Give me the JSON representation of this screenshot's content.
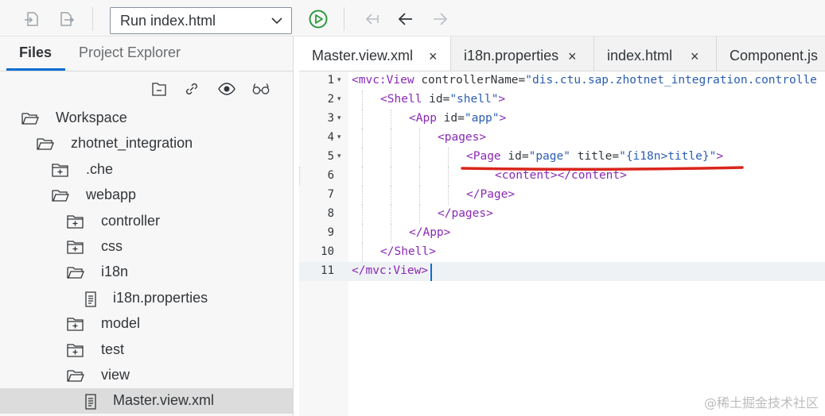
{
  "toolbar": {
    "run_config_label": "Run index.html",
    "icons": [
      "import-icon",
      "export-icon",
      "run-icon",
      "step-back-icon",
      "back-icon",
      "forward-icon"
    ]
  },
  "left_pane": {
    "tabs": [
      {
        "label": "Files",
        "active": true
      },
      {
        "label": "Project Explorer",
        "active": false
      }
    ],
    "action_icons": [
      "new-folder-icon",
      "link-icon",
      "eye-icon",
      "glasses-icon"
    ],
    "tree": [
      {
        "label": "Workspace",
        "type": "folder-open",
        "depth": 0
      },
      {
        "label": "zhotnet_integration",
        "type": "folder-open",
        "depth": 1
      },
      {
        "label": ".che",
        "type": "folder-closed",
        "depth": 2
      },
      {
        "label": "webapp",
        "type": "folder-open",
        "depth": 2
      },
      {
        "label": "controller",
        "type": "folder-closed",
        "depth": 3
      },
      {
        "label": "css",
        "type": "folder-closed",
        "depth": 3
      },
      {
        "label": "i18n",
        "type": "folder-open",
        "depth": 3
      },
      {
        "label": "i18n.properties",
        "type": "file",
        "depth": 4
      },
      {
        "label": "model",
        "type": "folder-closed",
        "depth": 3
      },
      {
        "label": "test",
        "type": "folder-closed",
        "depth": 3
      },
      {
        "label": "view",
        "type": "folder-open",
        "depth": 3
      },
      {
        "label": "Master.view.xml",
        "type": "file",
        "depth": 4,
        "selected": true
      }
    ]
  },
  "editor": {
    "tabs": [
      {
        "label": "Master.view.xml",
        "active": true,
        "close": "×"
      },
      {
        "label": "i18n.properties",
        "active": false,
        "close": "×"
      },
      {
        "label": "index.html",
        "active": false,
        "close": "×"
      },
      {
        "label": "Component.js",
        "active": false,
        "close": ""
      }
    ],
    "lines": [
      {
        "n": "1",
        "fold": true,
        "tokens": [
          [
            "tag",
            "<mvc:View "
          ],
          [
            "attr",
            "controllerName="
          ],
          [
            "str",
            "\"dis.ctu.sap.zhotnet_integration.controlle"
          ]
        ]
      },
      {
        "n": "2",
        "fold": true,
        "tokens": [
          [
            "tag",
            "<Shell "
          ],
          [
            "attr",
            "id="
          ],
          [
            "str",
            "\"shell\""
          ],
          [
            "tag",
            ">"
          ]
        ]
      },
      {
        "n": "3",
        "fold": true,
        "tokens": [
          [
            "tag",
            "<App "
          ],
          [
            "attr",
            "id="
          ],
          [
            "str",
            "\"app\""
          ],
          [
            "tag",
            ">"
          ]
        ]
      },
      {
        "n": "4",
        "fold": true,
        "tokens": [
          [
            "tag",
            "<pages>"
          ]
        ]
      },
      {
        "n": "5",
        "fold": true,
        "tokens": [
          [
            "tag",
            "<Page "
          ],
          [
            "attr",
            "id="
          ],
          [
            "str",
            "\"page\""
          ],
          [
            "attr",
            " title="
          ],
          [
            "str",
            "\"{i18n>title}\""
          ],
          [
            "tag",
            ">"
          ]
        ]
      },
      {
        "n": "6",
        "fold": false,
        "tokens": [
          [
            "tag",
            "<content></content>"
          ]
        ]
      },
      {
        "n": "7",
        "fold": false,
        "tokens": [
          [
            "tag",
            "</Page>"
          ]
        ]
      },
      {
        "n": "8",
        "fold": false,
        "tokens": [
          [
            "tag",
            "</pages>"
          ]
        ]
      },
      {
        "n": "9",
        "fold": false,
        "tokens": [
          [
            "tag",
            "</App>"
          ]
        ]
      },
      {
        "n": "10",
        "fold": false,
        "tokens": [
          [
            "tag",
            "</Shell>"
          ]
        ]
      },
      {
        "n": "11",
        "fold": false,
        "tokens": [
          [
            "tag",
            "</mvc:View>"
          ]
        ],
        "current": true
      }
    ]
  },
  "watermark": "@稀土掘金技术社区",
  "colors": {
    "accent": "#0a6ed1",
    "run_green": "#2b9a3e",
    "xml_tag": "#8a29b5",
    "xml_string": "#2a5db0",
    "annotation_red": "#d9251c"
  }
}
